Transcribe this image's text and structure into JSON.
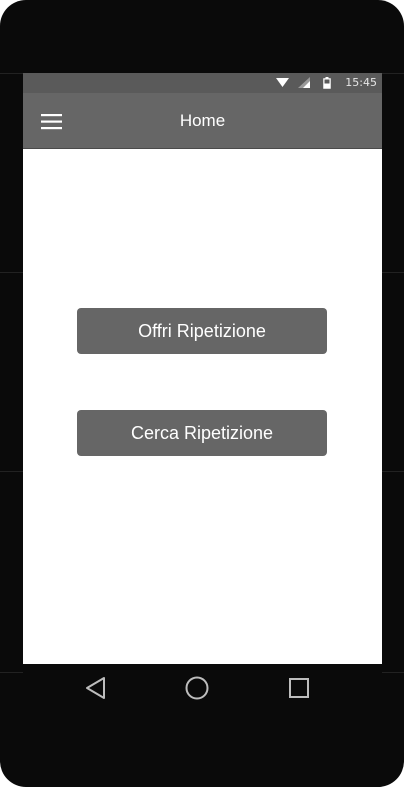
{
  "status_bar": {
    "time": "15:45",
    "icons": [
      "wifi-icon",
      "cellular-signal-icon",
      "battery-icon"
    ]
  },
  "app_bar": {
    "menu_icon": "hamburger-menu-icon",
    "title": "Home"
  },
  "main": {
    "buttons": [
      {
        "label": "Offri Ripetizione"
      },
      {
        "label": "Cerca Ripetizione"
      }
    ]
  },
  "nav_bar": {
    "icons": [
      "back-triangle-icon",
      "home-circle-icon",
      "recents-square-icon"
    ]
  },
  "colors": {
    "status_bar": "#5a5a5a",
    "app_bar": "#666666",
    "button": "#666666",
    "bezel": "#0a0a0a",
    "background": "#ffffff"
  }
}
